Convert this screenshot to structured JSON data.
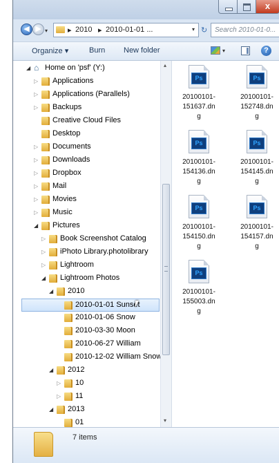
{
  "window": {
    "close_label": "x"
  },
  "address": {
    "crumbs": [
      "2010",
      "2010-01-01 ..."
    ],
    "search_placeholder": "Search 2010-01-0...",
    "back_glyph": "◀",
    "forward_glyph": "▶",
    "history_glyph": "▾",
    "dropdown_glyph": "▾",
    "separator": "▸",
    "refresh_glyph": "↻"
  },
  "toolbar": {
    "organize": "Organize ▾",
    "burn": "Burn",
    "new_folder": "New folder",
    "help": "?"
  },
  "tree": [
    {
      "label": "Home on 'psf' (Y:)",
      "indent": 0,
      "icon": "home",
      "arrow": "open"
    },
    {
      "label": "Applications",
      "indent": 1,
      "icon": "folder",
      "arrow": "closed"
    },
    {
      "label": "Applications (Parallels)",
      "indent": 1,
      "icon": "folder",
      "arrow": "closed"
    },
    {
      "label": "Backups",
      "indent": 1,
      "icon": "folder",
      "arrow": "closed"
    },
    {
      "label": "Creative Cloud Files",
      "indent": 1,
      "icon": "folder",
      "arrow": "none"
    },
    {
      "label": "Desktop",
      "indent": 1,
      "icon": "folder",
      "arrow": "none"
    },
    {
      "label": "Documents",
      "indent": 1,
      "icon": "folder",
      "arrow": "closed"
    },
    {
      "label": "Downloads",
      "indent": 1,
      "icon": "folder",
      "arrow": "closed"
    },
    {
      "label": "Dropbox",
      "indent": 1,
      "icon": "folder",
      "arrow": "closed"
    },
    {
      "label": "Mail",
      "indent": 1,
      "icon": "folder",
      "arrow": "closed"
    },
    {
      "label": "Movies",
      "indent": 1,
      "icon": "folder",
      "arrow": "closed"
    },
    {
      "label": "Music",
      "indent": 1,
      "icon": "folder",
      "arrow": "closed"
    },
    {
      "label": "Pictures",
      "indent": 1,
      "icon": "folder",
      "arrow": "open"
    },
    {
      "label": "Book Screenshot Catalog",
      "indent": 2,
      "icon": "folder",
      "arrow": "closed"
    },
    {
      "label": "iPhoto Library.photolibrary",
      "indent": 2,
      "icon": "folder",
      "arrow": "closed"
    },
    {
      "label": "Lightroom",
      "indent": 2,
      "icon": "folder",
      "arrow": "closed"
    },
    {
      "label": "Lightroom Photos",
      "indent": 2,
      "icon": "folder",
      "arrow": "open"
    },
    {
      "label": "2010",
      "indent": 3,
      "icon": "folder",
      "arrow": "open"
    },
    {
      "label": "2010-01-01 Sunset",
      "indent": 4,
      "icon": "folder",
      "arrow": "none",
      "selected": true
    },
    {
      "label": "2010-01-06 Snow",
      "indent": 4,
      "icon": "folder",
      "arrow": "none"
    },
    {
      "label": "2010-03-30 Moon",
      "indent": 4,
      "icon": "folder",
      "arrow": "none"
    },
    {
      "label": "2010-06-27 William",
      "indent": 4,
      "icon": "folder",
      "arrow": "none"
    },
    {
      "label": "2010-12-02 William Snow",
      "indent": 4,
      "icon": "folder",
      "arrow": "none"
    },
    {
      "label": "2012",
      "indent": 3,
      "icon": "folder",
      "arrow": "open"
    },
    {
      "label": "10",
      "indent": 4,
      "icon": "folder",
      "arrow": "closed"
    },
    {
      "label": "11",
      "indent": 4,
      "icon": "folder",
      "arrow": "closed"
    },
    {
      "label": "2013",
      "indent": 3,
      "icon": "folder",
      "arrow": "open"
    },
    {
      "label": "01",
      "indent": 4,
      "icon": "folder",
      "arrow": "none"
    }
  ],
  "files": [
    {
      "lines": [
        "20100101-",
        "151637.dn",
        "g"
      ],
      "badge": "Ps"
    },
    {
      "lines": [
        "20100101-",
        "152748.dn",
        "g"
      ],
      "badge": "Ps"
    },
    {
      "lines": [
        "20100101-",
        "154136.dn",
        "g"
      ],
      "badge": "Ps"
    },
    {
      "lines": [
        "20100101-",
        "154145.dn",
        "g"
      ],
      "badge": "Ps"
    },
    {
      "lines": [
        "20100101-",
        "154150.dn",
        "g"
      ],
      "badge": "Ps"
    },
    {
      "lines": [
        "20100101-",
        "154157.dn",
        "g"
      ],
      "badge": "Ps"
    },
    {
      "lines": [
        "20100101-",
        "155003.dn",
        "g"
      ],
      "badge": "Ps"
    }
  ],
  "details": {
    "count": "7 items"
  },
  "scroll": {
    "up": "▴",
    "down": "▾"
  }
}
